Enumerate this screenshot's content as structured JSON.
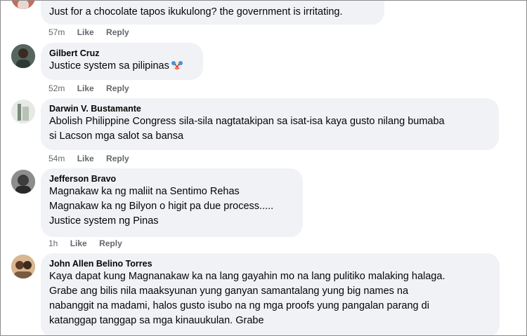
{
  "comments": [
    {
      "author": "",
      "lines": [
        "Just for a chocolate tapos ikukulong? the government is irritating."
      ],
      "time": "57m",
      "like": "Like",
      "reply": "Reply"
    },
    {
      "author": "Gilbert Cruz",
      "lines": [
        "Justice system sa pilipinas"
      ],
      "emoji": "clown-face-emoji",
      "time": "52m",
      "like": "Like",
      "reply": "Reply"
    },
    {
      "author": "Darwin V. Bustamante",
      "lines": [
        "Abolish Philippine Congress sila-sila nagtatakipan sa isat-isa kaya gusto nilang bumaba",
        "si Lacson mga salot sa bansa"
      ],
      "time": "54m",
      "like": "Like",
      "reply": "Reply"
    },
    {
      "author": "Jefferson Bravo",
      "lines": [
        "Magnakaw ka ng maliit na Sentimo Rehas",
        "Magnakaw ka ng Bilyon o higit pa due process.....",
        "Justice system ng Pinas"
      ],
      "time": "1h",
      "like": "Like",
      "reply": "Reply"
    },
    {
      "author": "John Allen Belino Torres",
      "lines": [
        "Kaya dapat kung Magnanakaw ka na lang gayahin mo na lang pulitiko malaking halaga.",
        "Grabe ang bilis nila maaksyunan yung ganyan samantalang yung big names na",
        "nabanggit na madami, halos gusto isubo na ng mga proofs yung pangalan parang di",
        "katanggap tanggap sa mga kinauukulan. Grabe"
      ]
    }
  ]
}
